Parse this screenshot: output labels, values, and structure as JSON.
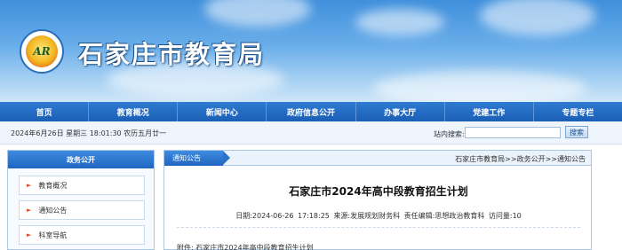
{
  "header": {
    "site_title": "石家庄市教育局",
    "logo_text": "AR"
  },
  "nav": {
    "items": [
      {
        "label": "首页"
      },
      {
        "label": "教育概况"
      },
      {
        "label": "新闻中心"
      },
      {
        "label": "政府信息公开"
      },
      {
        "label": "办事大厅"
      },
      {
        "label": "党建工作"
      },
      {
        "label": "专题专栏"
      }
    ]
  },
  "infobar": {
    "date": "2024年6月26日 星期三 18:01:30 农历五月廿一",
    "search_label": "站内搜索:",
    "search_value": "",
    "search_button": "搜索"
  },
  "sidebar": {
    "title": "政务公开",
    "items": [
      {
        "label": "教育概况"
      },
      {
        "label": "通知公告"
      },
      {
        "label": "科室导航"
      }
    ]
  },
  "main": {
    "tab_label": "通知公告",
    "breadcrumb": "石家庄市教育局>>政务公开>>通知公告",
    "article_title": "石家庄市2024年高中段教育招生计划",
    "meta": "日期:2024-06-26 17:18:25  来源:发展规划财务科  责任编辑:思想政治教育科  访问量:10",
    "attachment": "附件: 石家庄市2024年高中段教育招生计划"
  }
}
